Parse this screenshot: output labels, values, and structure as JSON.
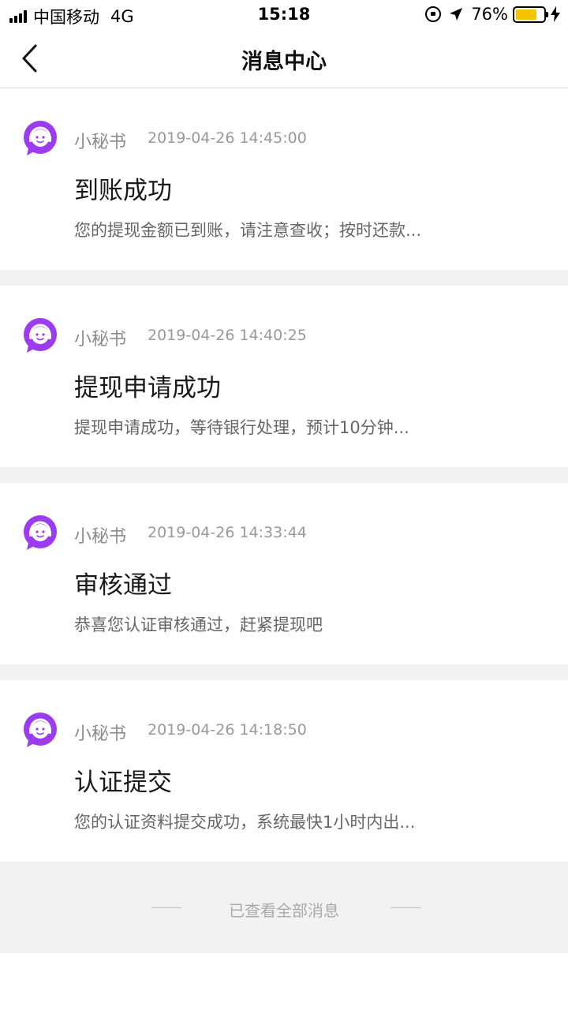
{
  "status_bar": {
    "carrier": "中国移动",
    "network": "4G",
    "time": "15:18",
    "battery": "76%",
    "battery_level": 0.76,
    "battery_color": "#f5c400"
  },
  "nav": {
    "title": "消息中心",
    "back_icon": "chevron-left-icon"
  },
  "messages": [
    {
      "sender": "小秘书",
      "time": "2019-04-26 14:45:00",
      "title": "到账成功",
      "summary": "您的提现金额已到账，请注意查收；按时还款..."
    },
    {
      "sender": "小秘书",
      "time": "2019-04-26 14:40:25",
      "title": "提现申请成功",
      "summary": "提现申请成功，等待银行处理，预计10分钟..."
    },
    {
      "sender": "小秘书",
      "time": "2019-04-26 14:33:44",
      "title": "审核通过",
      "summary": "恭喜您认证审核通过，赶紧提现吧"
    },
    {
      "sender": "小秘书",
      "time": "2019-04-26 14:18:50",
      "title": "认证提交",
      "summary": "您的认证资料提交成功，系统最快1小时内出..."
    }
  ],
  "footer": {
    "text": "已查看全部消息"
  },
  "colors": {
    "avatar_purple": "#9b3cf0",
    "background_gray": "#f2f2f2"
  }
}
